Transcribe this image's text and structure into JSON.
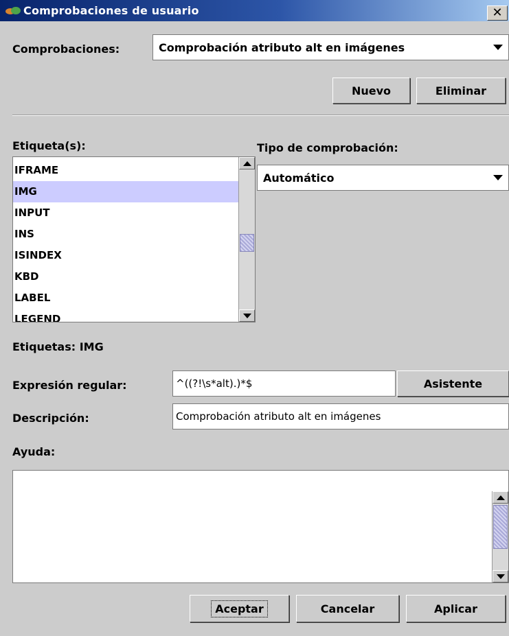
{
  "window": {
    "title": "Comprobaciones de usuario",
    "close_glyph": "✕"
  },
  "checks": {
    "label": "Comprobaciones:",
    "selected": "Comprobación atributo alt en imágenes"
  },
  "buttons": {
    "new": "Nuevo",
    "delete": "Eliminar",
    "wizard": "Asistente",
    "accept": "Aceptar",
    "cancel": "Cancelar",
    "apply": "Aplicar"
  },
  "tags": {
    "label": "Etiqueta(s):",
    "items": [
      "IFRAME",
      "IMG",
      "INPUT",
      "INS",
      "ISINDEX",
      "KBD",
      "LABEL",
      "LEGEND"
    ],
    "selected_index": 1,
    "summary_label": "Etiquetas:",
    "summary_value": "IMG"
  },
  "check_type": {
    "label": "Tipo de comprobación:",
    "selected": "Automático"
  },
  "regex": {
    "label": "Expresión regular:",
    "value": "^((?!\\s*alt).)*$"
  },
  "description": {
    "label": "Descripción:",
    "value": "Comprobación atributo alt en imágenes"
  },
  "help": {
    "label": "Ayuda:",
    "value": ""
  },
  "icons": {
    "app": "app-icon",
    "close": "close-icon"
  },
  "colors": {
    "title_bar": "#08246b",
    "selection": "#ccccff",
    "background": "#cccccc"
  }
}
